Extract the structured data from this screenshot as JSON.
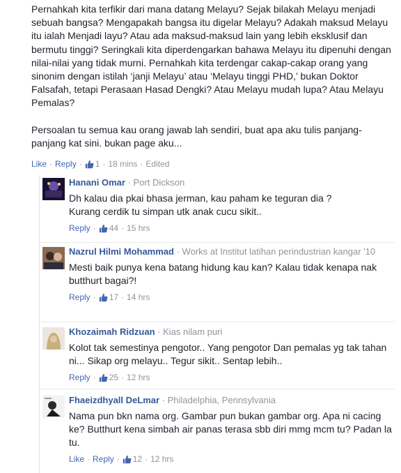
{
  "main": {
    "text": "Pernahkah kita terfikir dari mana datang Melayu? Sejak bilakah Melayu menjadi sebuah bangsa? Mengapakah bangsa itu digelar Melayu? Adakah maksud Melayu itu ialah Menjadi layu? Atau ada maksud-maksud lain yang lebih eksklusif dan bermutu tinggi? Seringkali kita diperdengarkan bahawa Melayu itu dipenuhi dengan nilai-nilai yang tidak murni. Pernahkah kita terdengar cakap-cakap orang yang sinonim dengan istilah ‘janji Melayu’ atau ‘Melayu tinggi PHD,’ bukan Doktor Falsafah, tetapi Perasaan Hasad Dengki? Atau Melayu mudah lupa? Atau Melayu Pemalas?\n\nPersoalan tu semua kau orang jawab lah sendiri, buat apa aku tulis panjang-panjang kat sini. bukan page aku...",
    "like": "Like",
    "reply": "Reply",
    "likes": "1",
    "time": "18 mins",
    "edited": "Edited"
  },
  "replies": [
    {
      "name": "Hanani Omar",
      "location": "Port Dickson",
      "text": "Dh kalau dia pkai bhasa jerman, kau paham ke teguran dia ?\nKurang cerdik tu simpan utk anak cucu sikit..",
      "reply": "Reply",
      "likes": "44",
      "time": "15 hrs"
    },
    {
      "name": "Nazrul Hilmi Mohammad",
      "location": "Works at Institut latihan perindustrian kangar '10",
      "text": "Mesti baik punya kena batang hidung kau kan? Kalau tidak kenapa nak butthurt bagai?!",
      "reply": "Reply",
      "likes": "17",
      "time": "14 hrs"
    },
    {
      "name": "Khozaimah Ridzuan",
      "location": "Kias nilam puri",
      "text": "Kolot tak semestinya pengotor.. Yang pengotor Dan pemalas yg tak tahan ni... Sikap org melayu.. Tegur sikit.. Sentap lebih..",
      "reply": "Reply",
      "likes": "25",
      "time": "12 hrs"
    },
    {
      "name": "Fhaeizdhyall DeLmar",
      "location": "Philadelphia, Pennsylvania",
      "text": "Nama pun bkn nama org. Gambar pun bukan gambar org. Apa ni cacing ke? Butthurt kena simbah air panas terasa sbb diri mmg mcm tu? Padan la tu.",
      "like": "Like",
      "reply": "Reply",
      "likes": "12",
      "time": "12 hrs"
    }
  ],
  "colors": {
    "link": "#4267b2",
    "name": "#365899",
    "meta": "#90949c",
    "text": "#1d2129"
  }
}
